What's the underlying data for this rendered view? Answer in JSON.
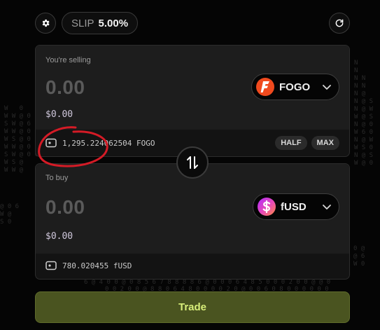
{
  "top_bar": {
    "settings_icon": "gear-icon",
    "slippage_label": "SLIP",
    "slippage_value": "5.00%",
    "refresh_icon": "refresh-icon"
  },
  "sell": {
    "caption": "You're selling",
    "amount": "0.00",
    "usd_value": "$0.00",
    "token": "FOGO",
    "token_icon": "fogo-flame-icon",
    "balance": "1,295.224062504 FOGO",
    "half_label": "HALF",
    "max_label": "MAX"
  },
  "buy": {
    "caption": "To buy",
    "amount": "0.00",
    "usd_value": "$0.00",
    "token": "fUSD",
    "token_icon": "fusd-dollar-icon",
    "balance": "780.020455 fUSD"
  },
  "trade_label": "Trade",
  "colors": {
    "fogo": "#f04a1e",
    "trade_bg": "#4a5420",
    "trade_text": "#d8ee7a",
    "annotation": "#d41b26"
  }
}
